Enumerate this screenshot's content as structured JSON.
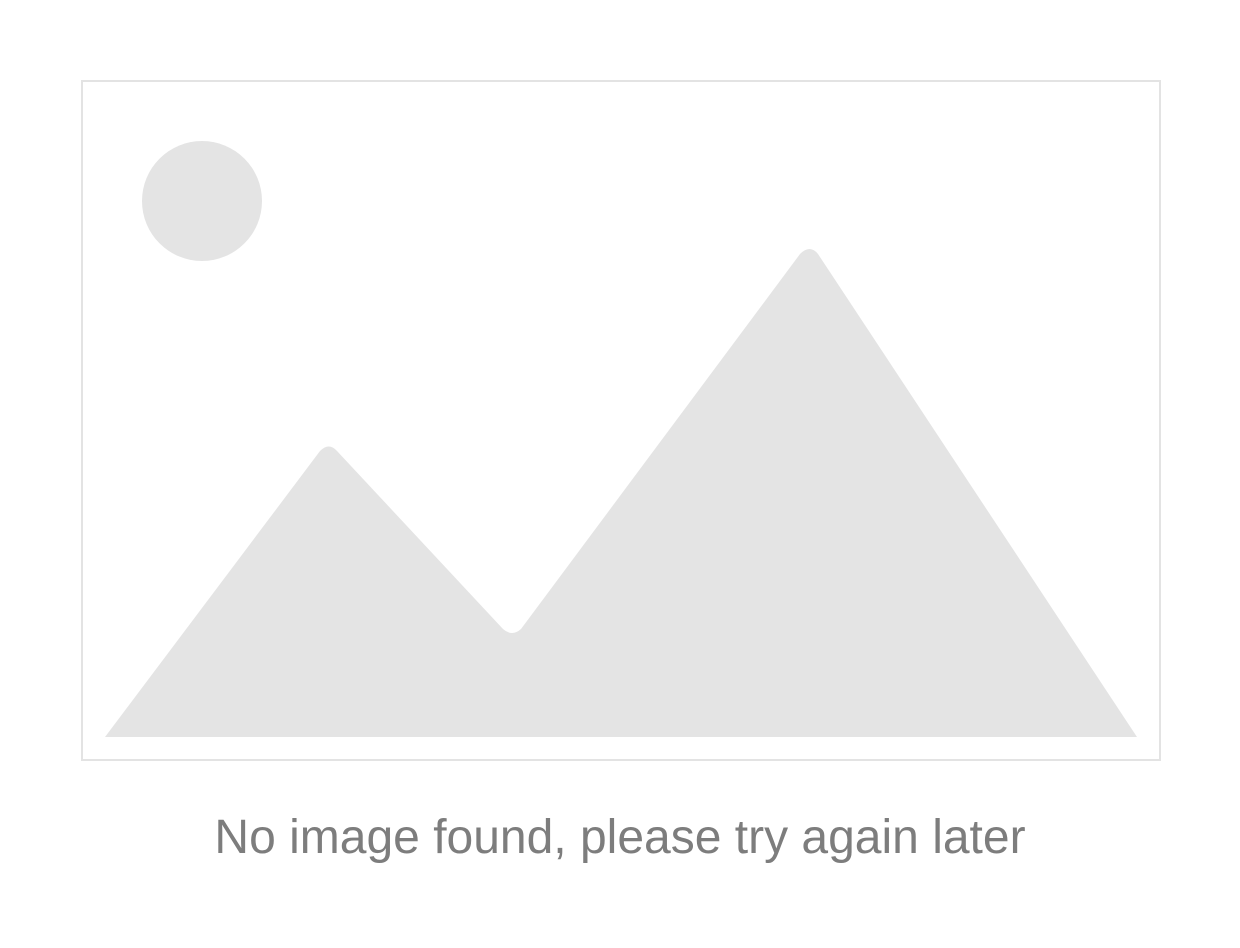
{
  "placeholder": {
    "icon": "image-placeholder-icon",
    "colors": {
      "frame_border": "#e3e3e3",
      "shape_fill": "#e4e4e4",
      "text": "#7d7d7d",
      "background": "#ffffff"
    }
  },
  "message": "No image found, please try again later"
}
